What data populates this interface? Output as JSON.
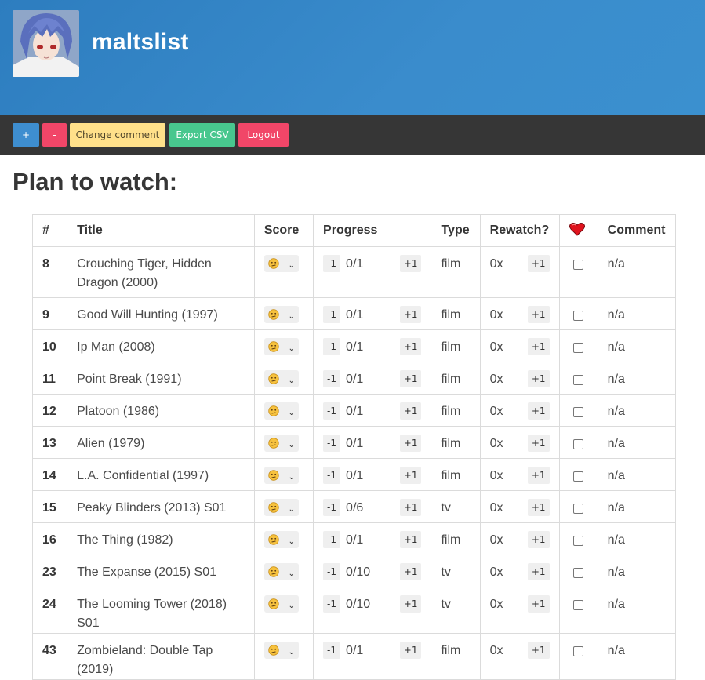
{
  "header": {
    "site_title": "maltslist"
  },
  "toolbar": {
    "add_label": "+",
    "remove_label": "-",
    "change_comment_label": "Change comment",
    "export_csv_label": "Export CSV",
    "logout_label": "Logout",
    "colors": {
      "add": "#3e8ed0",
      "remove": "#f14668",
      "comment": "#ffe08a",
      "export": "#48c78e",
      "logout": "#f14668"
    }
  },
  "section": {
    "title": "Plan to watch:"
  },
  "table": {
    "headers": {
      "num": "#",
      "title": "Title",
      "score": "Score",
      "progress": "Progress",
      "type": "Type",
      "rewatch": "Rewatch?",
      "favorite_icon": "heart-icon",
      "comment": "Comment"
    },
    "decrement_label": "-1",
    "increment_label": "+1",
    "score_icon": "confused-face-icon",
    "rows": [
      {
        "num": "8",
        "title": "Crouching Tiger, Hidden Dragon (2000)",
        "progress": "0/1",
        "type": "film",
        "rewatch": "0x",
        "comment": "n/a"
      },
      {
        "num": "9",
        "title": "Good Will Hunting (1997)",
        "progress": "0/1",
        "type": "film",
        "rewatch": "0x",
        "comment": "n/a"
      },
      {
        "num": "10",
        "title": "Ip Man (2008)",
        "progress": "0/1",
        "type": "film",
        "rewatch": "0x",
        "comment": "n/a"
      },
      {
        "num": "11",
        "title": "Point Break (1991)",
        "progress": "0/1",
        "type": "film",
        "rewatch": "0x",
        "comment": "n/a"
      },
      {
        "num": "12",
        "title": "Platoon (1986)",
        "progress": "0/1",
        "type": "film",
        "rewatch": "0x",
        "comment": "n/a"
      },
      {
        "num": "13",
        "title": "Alien (1979)",
        "progress": "0/1",
        "type": "film",
        "rewatch": "0x",
        "comment": "n/a"
      },
      {
        "num": "14",
        "title": "L.A. Confidential (1997)",
        "progress": "0/1",
        "type": "film",
        "rewatch": "0x",
        "comment": "n/a"
      },
      {
        "num": "15",
        "title": "Peaky Blinders (2013) S01",
        "progress": "0/6",
        "type": "tv",
        "rewatch": "0x",
        "comment": "n/a"
      },
      {
        "num": "16",
        "title": "The Thing (1982)",
        "progress": "0/1",
        "type": "film",
        "rewatch": "0x",
        "comment": "n/a"
      },
      {
        "num": "23",
        "title": "The Expanse (2015) S01",
        "progress": "0/10",
        "type": "tv",
        "rewatch": "0x",
        "comment": "n/a"
      },
      {
        "num": "24",
        "title": "The Looming Tower (2018) S01",
        "progress": "0/10",
        "type": "tv",
        "rewatch": "0x",
        "comment": "n/a"
      },
      {
        "num": "43",
        "title": "Zombieland: Double Tap (2019)",
        "progress": "0/1",
        "type": "film",
        "rewatch": "0x",
        "comment": "n/a"
      }
    ]
  }
}
